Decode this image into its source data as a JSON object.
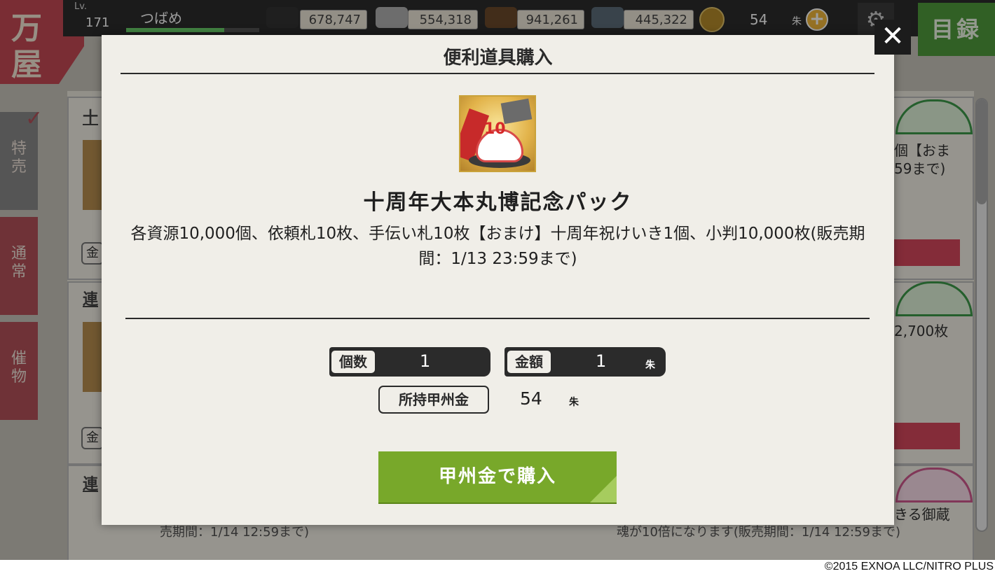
{
  "header": {
    "shop_logo": [
      "万",
      "屋"
    ],
    "level_label": "Lv.",
    "level": "171",
    "player_name": "つばめ",
    "resources": [
      {
        "name": "charcoal",
        "value": "678,747",
        "color": "#333333"
      },
      {
        "name": "steel",
        "value": "554,318",
        "color": "#b0b0b0"
      },
      {
        "name": "cooling-material",
        "value": "941,261",
        "color": "#6b4a2a"
      },
      {
        "name": "whetstone",
        "value": "445,322",
        "color": "#5d6d7a"
      }
    ],
    "koshu_gold": {
      "value": "54",
      "unit": "朱"
    },
    "mokuroku_label": "目録"
  },
  "side_tabs": [
    {
      "label": "特売",
      "name": "tab-special"
    },
    {
      "label": "通常",
      "name": "tab-normal"
    },
    {
      "label": "催物",
      "name": "tab-event"
    }
  ],
  "background_list": {
    "row_tags": [
      "十",
      "連",
      "連"
    ],
    "kin": "金",
    "side_texts": [
      "個【おま",
      "59まで)",
      "2,700枚",
      "きる御蔵"
    ],
    "bottom_left": "売期間：1/14 12:59まで)",
    "bottom_right": "魂が10倍になります(販売期間：1/14 12:59まで)"
  },
  "modal": {
    "title": "便利道具購入",
    "close_label": "✕",
    "item_name": "十周年大本丸博記念パック",
    "item_icon_text": "10",
    "item_description": "各資源10,000個、依頼札10枚、手伝い札10枚【おまけ】十周年祝けいき1個、小判10,000枚(販売期間：1/13 23:59まで)",
    "quantity_label": "個数",
    "quantity_value": "1",
    "price_label": "金額",
    "price_value": "1",
    "price_unit": "朱",
    "owned_label": "所持甲州金",
    "owned_value": "54",
    "owned_unit": "朱",
    "buy_button_label": "甲州金で購入"
  },
  "copyright": "©2015 EXNOA LLC/NITRO PLUS"
}
